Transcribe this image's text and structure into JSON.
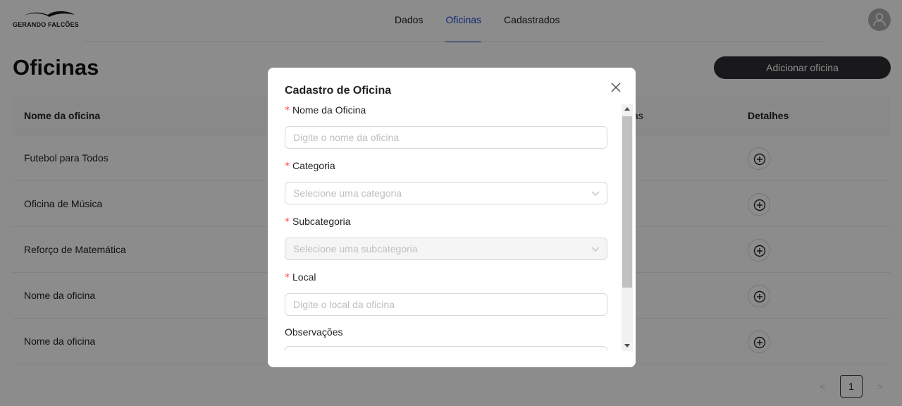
{
  "header": {
    "logo_text": "GERANDO FALCÕES",
    "nav": [
      {
        "label": "Dados",
        "active": false
      },
      {
        "label": "Oficinas",
        "active": true
      },
      {
        "label": "Cadastrados",
        "active": false
      }
    ],
    "accent_color": "#1f4fd8"
  },
  "page": {
    "title": "Oficinas",
    "add_button_label": "Adicionar oficina"
  },
  "table": {
    "columns": [
      "Nome da oficina",
      "Detalhes"
    ],
    "partial_column_fragment": "as",
    "rows": [
      {
        "name": "Futebol para Todos"
      },
      {
        "name": "Oficina de Música"
      },
      {
        "name": "Reforço de Matemática"
      },
      {
        "name": "Nome da oficina"
      },
      {
        "name": "Nome da oficina"
      }
    ]
  },
  "pagination": {
    "current_page": "1",
    "prev": "<",
    "next": ">"
  },
  "modal": {
    "title": "Cadastro de Oficina",
    "fields": {
      "nome": {
        "label": "Nome da Oficina",
        "required": "*",
        "placeholder": "Digite o nome da oficina"
      },
      "categoria": {
        "label": "Categoria",
        "required": "*",
        "placeholder": "Selecione uma categoria"
      },
      "subcategoria": {
        "label": "Subcategoria",
        "required": "*",
        "placeholder": "Selecione uma subcategoria"
      },
      "local": {
        "label": "Local",
        "required": "*",
        "placeholder": "Digite o local da oficina"
      },
      "observacoes": {
        "label": "Observações"
      }
    }
  }
}
